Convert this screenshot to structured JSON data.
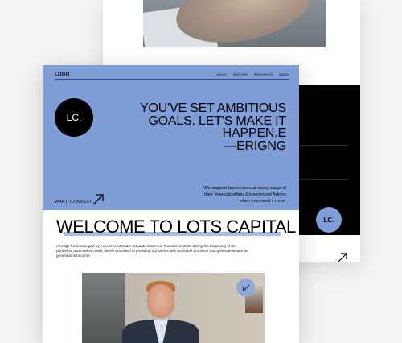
{
  "back_card": {
    "circle_label": "LC."
  },
  "front_card": {
    "nav": {
      "logo": "LOGO",
      "links": [
        "ABOUT",
        "SERVICES",
        "RESOURCES",
        "AGENT"
      ]
    },
    "hero": {
      "circle_label": "LC.",
      "headline_lines": [
        "YOU'VE SET AMBITIOUS",
        "GOALS. LET'S MAKE IT",
        "HAPPEN.E",
        "—ERIGNG"
      ],
      "cta_label": "WANT TO INVEST",
      "subtext_lines": [
        "We support businesses at every stage of",
        "their financial affairs.Experienced Advice",
        "when you need it most."
      ]
    },
    "welcome": {
      "title": "WELCOME TO LOTS CAPITAL",
      "intro_lines": [
        "A hedge fund managed by experienced trader Eduardo Ibarzona. Founded in 2020 during the beginning of the",
        "pandemic and market crash, we're committed to providing our clients with profitable portfolios that generate wealth for",
        "generations to come."
      ]
    }
  },
  "colors": {
    "accent_blue": "#7f9dd6",
    "black": "#000000",
    "background": "#f4f4f4"
  },
  "icons": [
    "arrow-up-right-icon",
    "arrow-down-left-icon"
  ]
}
